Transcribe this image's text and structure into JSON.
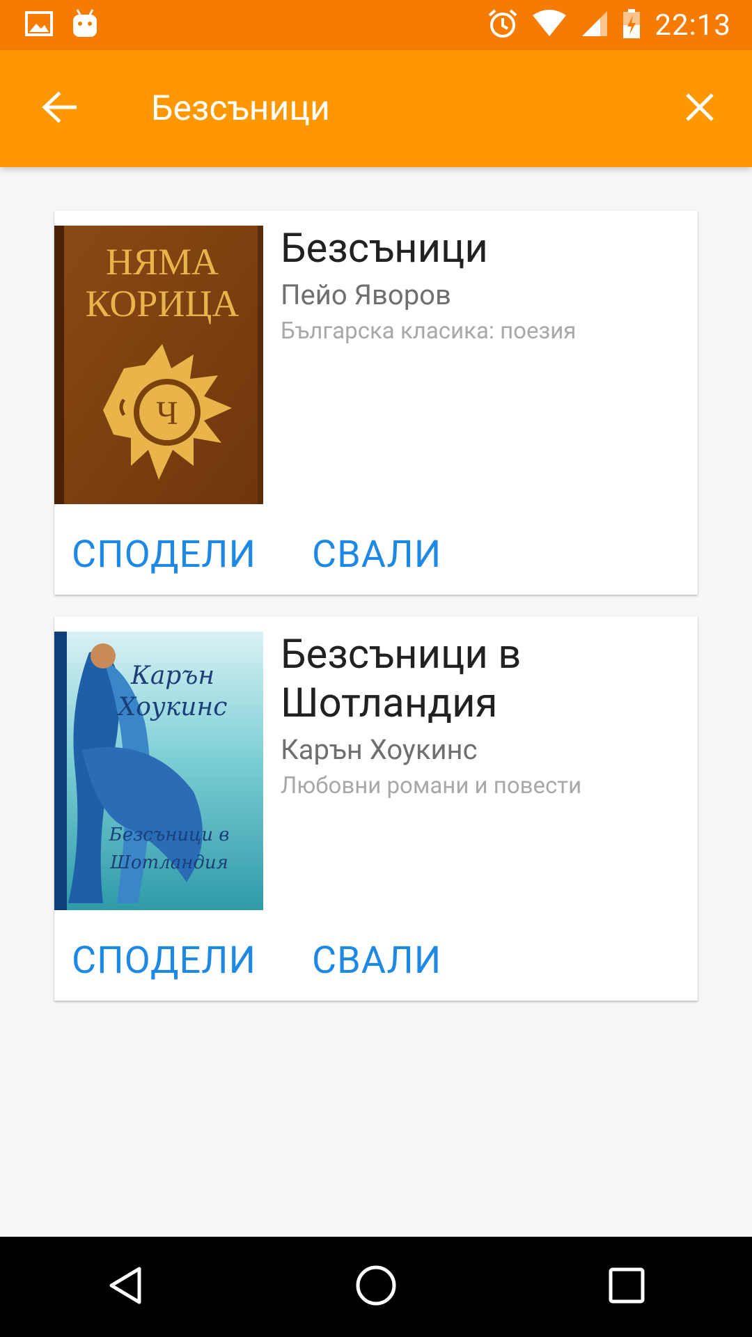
{
  "status_bar": {
    "time": "22:13",
    "icons": [
      "image-icon",
      "android-icon",
      "alarm-icon",
      "wifi-icon",
      "signal-icon",
      "battery-icon"
    ]
  },
  "app_bar": {
    "title": "Безсъници",
    "back_icon": "arrow-back-icon",
    "close_icon": "close-icon",
    "color": "#ff9800"
  },
  "results": [
    {
      "title": "Безсъници",
      "author": "Пейо Яворов",
      "genre": "Българска класика: поезия",
      "cover": {
        "line1": "НЯМА",
        "line2": "КОРИЦА",
        "emblem": "Ч"
      },
      "share_label": "СПОДЕЛИ",
      "download_label": "СВАЛИ"
    },
    {
      "title": "Безсъници в Шотландия",
      "author": "Карън Хоукинс",
      "genre": "Любовни романи и повести",
      "cover": {
        "author_line1": "Карън",
        "author_line2": "Хоукинс",
        "title_line1": "Безсъници в",
        "title_line2": "Шотландия"
      },
      "share_label": "СПОДЕЛИ",
      "download_label": "СВАЛИ"
    }
  ],
  "colors": {
    "status_bar": "#f57c00",
    "accent_text": "#1e88e5"
  },
  "nav_bar": {
    "icons": [
      "back-triangle-icon",
      "home-circle-icon",
      "recents-square-icon"
    ]
  }
}
